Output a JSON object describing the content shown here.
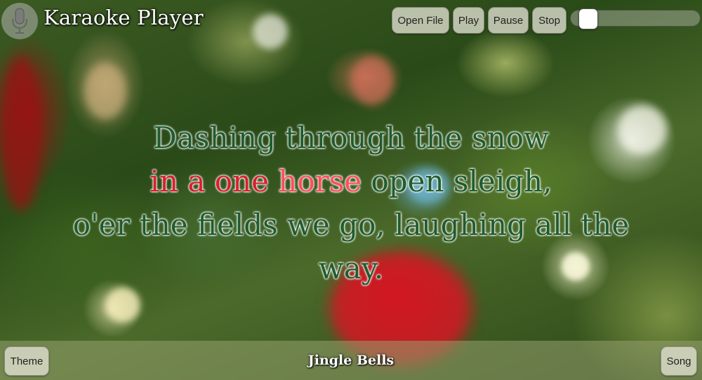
{
  "header": {
    "title": "Karaoke Player",
    "buttons": {
      "open_file": "Open File",
      "play": "Play",
      "pause": "Pause",
      "stop": "Stop"
    },
    "progress": 0.0
  },
  "lyrics": {
    "line1": "Dashing through the snow",
    "line2_sung": "in a one ",
    "line2_current": "horse",
    "line2_unsung": " open sleigh,",
    "line3": "o'er the fields we go, laughing all the way."
  },
  "footer": {
    "theme_label": "Theme",
    "song_title": "Jingle Bells",
    "song_label": "Song"
  },
  "colors": {
    "sung": "#d81f2a",
    "current": "#ff4d5a",
    "unsung": "#1f5c2e"
  },
  "icons": {
    "logo": "microphone-icon"
  }
}
